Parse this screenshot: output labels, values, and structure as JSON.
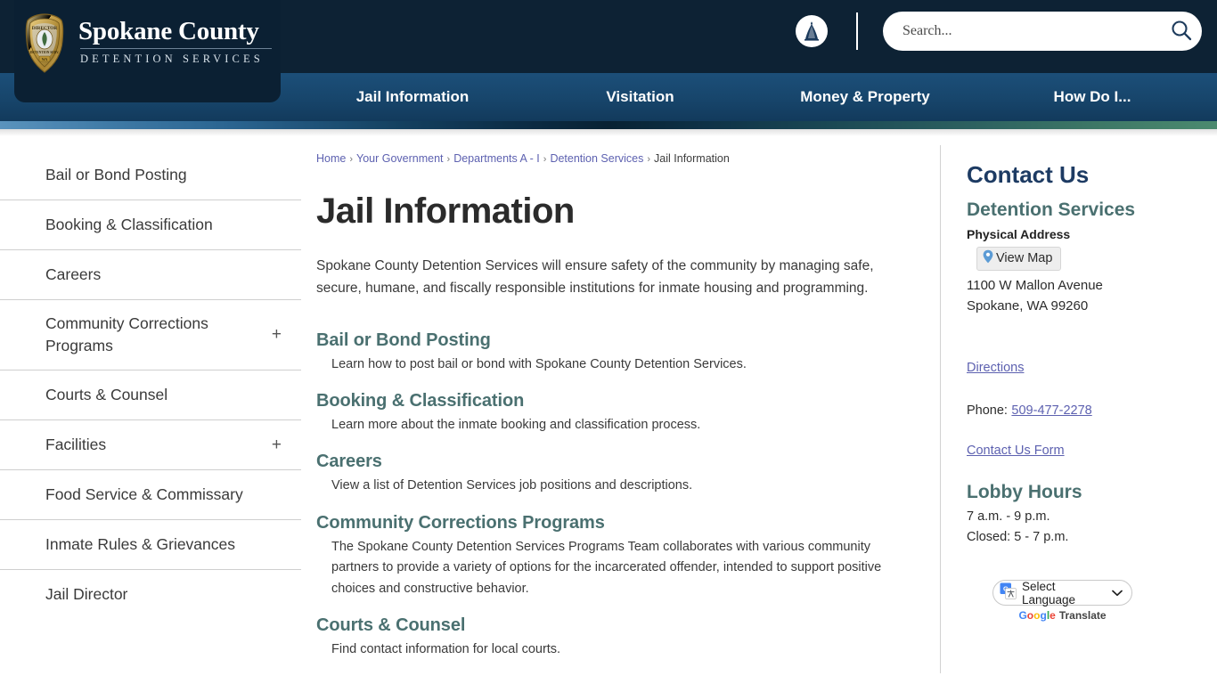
{
  "header": {
    "logo": {
      "badge_icon": "police-badge-icon",
      "title": "Spokane County",
      "subtitle": "DETENTION SERVICES"
    },
    "seal_icon": "county-seal-icon",
    "search": {
      "placeholder": "Search...",
      "value": "",
      "icon": "search-icon"
    },
    "nav": [
      {
        "label": "Jail Information"
      },
      {
        "label": "Visitation"
      },
      {
        "label": "Money & Property"
      },
      {
        "label": "How Do I..."
      }
    ]
  },
  "sidebar": {
    "items": [
      {
        "label": "Bail or Bond Posting",
        "expandable": false
      },
      {
        "label": "Booking & Classification",
        "expandable": false
      },
      {
        "label": "Careers",
        "expandable": false
      },
      {
        "label": "Community Corrections Programs",
        "expandable": true,
        "expand_glyph": "+"
      },
      {
        "label": "Courts & Counsel",
        "expandable": false
      },
      {
        "label": "Facilities",
        "expandable": true,
        "expand_glyph": "+"
      },
      {
        "label": "Food Service & Commissary",
        "expandable": false
      },
      {
        "label": "Inmate Rules & Grievances",
        "expandable": false
      },
      {
        "label": "Jail Director",
        "expandable": false
      }
    ]
  },
  "breadcrumb": {
    "items": [
      {
        "label": "Home",
        "link": true
      },
      {
        "label": "Your Government",
        "link": true
      },
      {
        "label": "Departments A - I",
        "link": true
      },
      {
        "label": "Detention Services",
        "link": true
      },
      {
        "label": "Jail Information",
        "link": false
      }
    ],
    "separator": "›"
  },
  "main": {
    "title": "Jail Information",
    "intro": "Spokane County Detention Services will ensure safety of the community by managing safe, secure, humane, and fiscally responsible institutions for inmate housing and programming.",
    "sections": [
      {
        "title": "Bail or Bond Posting",
        "description": "Learn how to post bail or bond with Spokane County Detention Services."
      },
      {
        "title": "Booking & Classification",
        "description": "Learn more about the inmate booking and classification process."
      },
      {
        "title": "Careers",
        "description": "View a list of Detention Services job positions and descriptions."
      },
      {
        "title": "Community Corrections Programs",
        "description": "The Spokane County Detention Services Programs Team collaborates with various community partners to provide a variety of options for the incarcerated offender, intended to support positive choices and constructive behavior."
      },
      {
        "title": "Courts & Counsel",
        "description": "Find contact information for local courts."
      }
    ]
  },
  "contact": {
    "heading": "Contact Us",
    "department": "Detention Services",
    "address_label": "Physical Address",
    "view_map_label": "View Map",
    "map_pin_icon": "map-pin-icon",
    "address_line1": "1100 W Mallon Avenue",
    "address_line2": "Spokane, WA 99260",
    "directions_label": "Directions",
    "phone_label": "Phone:",
    "phone_number": "509-477-2278",
    "contact_form_label": "Contact Us Form",
    "lobby_heading": "Lobby Hours",
    "lobby_line1": "7 a.m. - 9 p.m.",
    "lobby_line2": "Closed: 5 - 7 p.m."
  },
  "translate": {
    "select_label": "Select Language",
    "chevron_icon": "chevron-down-icon",
    "google_icon": "google-translate-icon",
    "credit_google": "Google",
    "credit_translate": "Translate",
    "google_letters": [
      "G",
      "o",
      "o",
      "g",
      "l",
      "e"
    ]
  },
  "colors": {
    "header_navy": "#0d2234",
    "nav_blue": "#17456b",
    "accent_teal": "#4a7070",
    "link_purple": "#5d61b0",
    "contact_heading": "#1d3b63"
  }
}
